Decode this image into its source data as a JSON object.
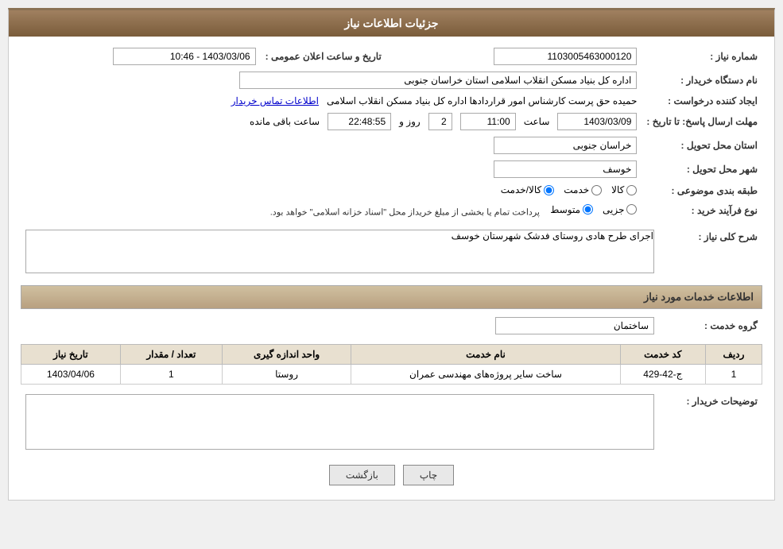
{
  "header": {
    "title": "جزئیات اطلاعات نیاز"
  },
  "fields": {
    "shomareNiaz_label": "شماره نیاز :",
    "shomareNiaz_value": "1103005463000120",
    "namDastgah_label": "نام دستگاه خریدار :",
    "namDastgah_value": "اداره کل بنیاد مسکن انقلاب اسلامی استان خراسان جنوبی",
    "eijadKonnande_label": "ایجاد کننده درخواست :",
    "eijadKonnande_value": "حمیده حق پرست کارشناس امور قراردادها اداره کل بنیاد مسکن انقلاب اسلامی",
    "eijadKonnande_link": "اطلاعات تماس خریدار",
    "tarikhErsalPasakh_label": "مهلت ارسال پاسخ: تا تاریخ :",
    "tarikhErsalDate": "1403/03/09",
    "saatLabel": "ساعت",
    "saatValue": "11:00",
    "rozValue": "2",
    "rozLabel": "روز و",
    "saatMande": "22:48:55",
    "saatMandeLabel": "ساعت باقی مانده",
    "tarikhElanLabel": "تاریخ و ساعت اعلان عمومی :",
    "tarikhElanValue": "1403/03/06 - 10:46",
    "ostanTahvilLabel": "استان محل تحویل :",
    "ostanTahvilValue": "خراسان جنوبی",
    "shahrTahvilLabel": "شهر محل تحویل :",
    "shahrTahvilValue": "خوسف",
    "tabaqehBandiLabel": "طبقه بندی موضوعی :",
    "tabaqehKala": "کالا",
    "tabaqehKhedmat": "خدمت",
    "tabaqehKalaKhedmat": "کالا/خدمت",
    "noFarayand_label": "نوع فرآیند خرید :",
    "noFarayandJozei": "جزیی",
    "noFarayandMotavasset": "متوسط",
    "noFarayandNote": "پرداخت تمام یا بخشی از مبلغ خریداز محل \"اسناد خزانه اسلامی\" خواهد بود.",
    "sharhKolliLabel": "شرح کلی نیاز :",
    "sharhKolliValue": "اجرای طرح هادی روستای فدشک شهرستان خوسف",
    "khadamatSection": "اطلاعات خدمات مورد نیاز",
    "groupeKhedmat_label": "گروه خدمت :",
    "groupeKhedmat_value": "ساختمان",
    "tableHeaders": {
      "radif": "ردیف",
      "kodKhedmat": "کد خدمت",
      "namKhedmat": "نام خدمت",
      "vahedAndazegiri": "واحد اندازه گیری",
      "tedad_megdar": "تعداد / مقدار",
      "tarikhNiaz": "تاریخ نیاز"
    },
    "tableRows": [
      {
        "radif": "1",
        "kodKhedmat": "ج-42-429",
        "namKhedmat": "ساخت سایر پروژه‌های مهندسی عمران",
        "vahedAndazegiri": "روستا",
        "tedad_megdar": "1",
        "tarikhNiaz": "1403/04/06"
      }
    ],
    "tosifatKharidar_label": "توضیحات خریدار :",
    "tosifatKharidar_value": ""
  },
  "buttons": {
    "print": "چاپ",
    "back": "بازگشت"
  }
}
